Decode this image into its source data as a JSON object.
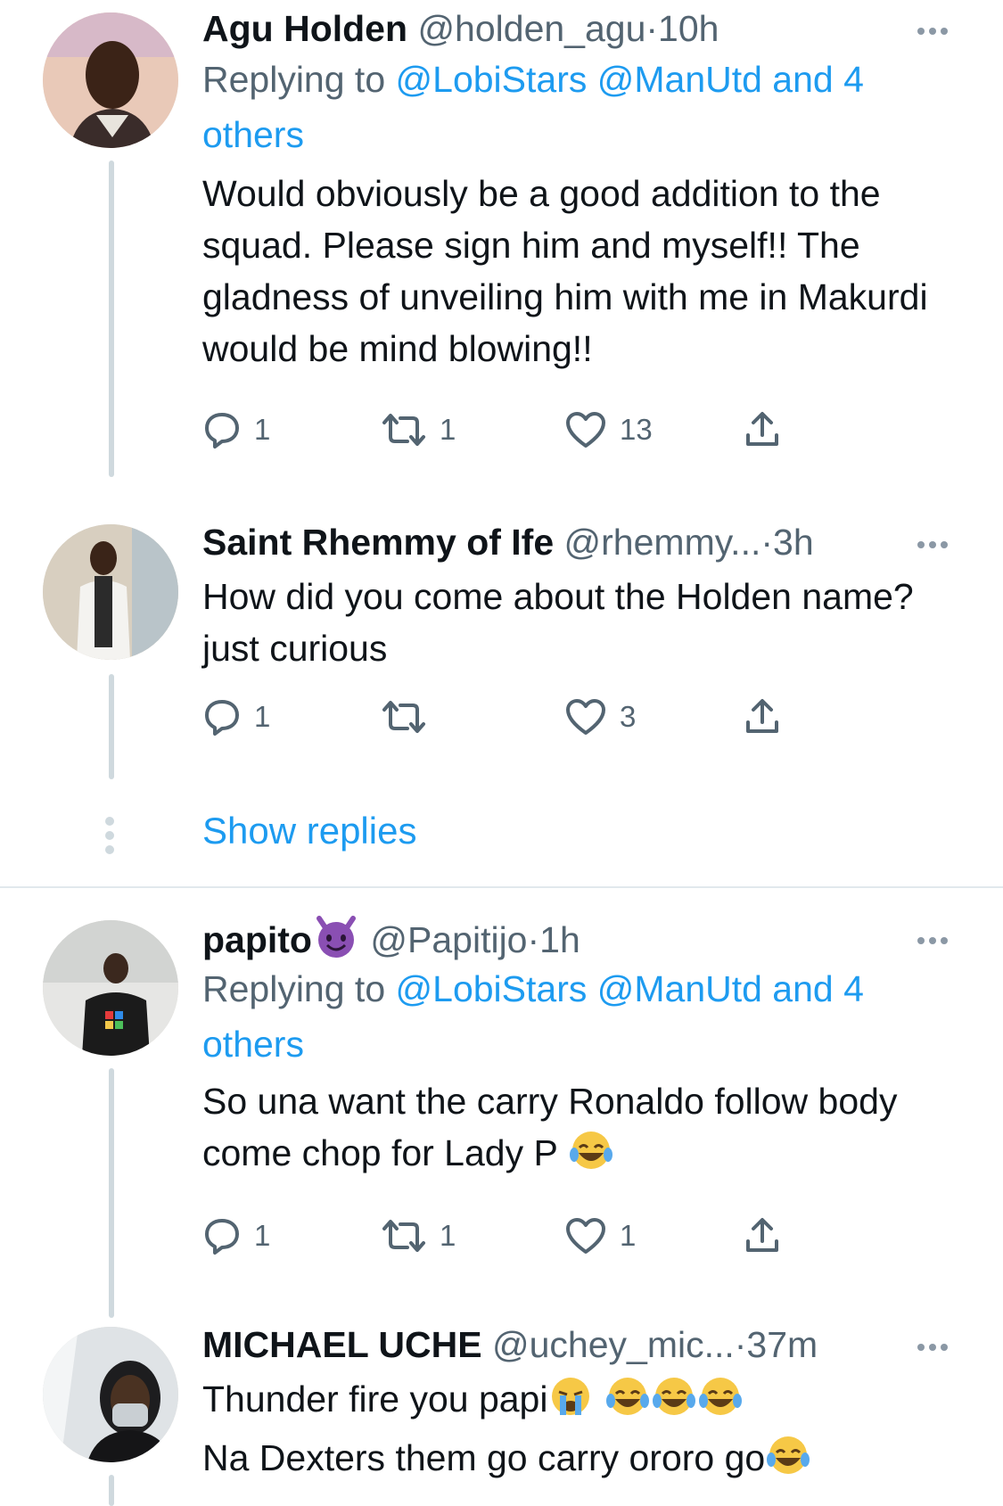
{
  "tweets": [
    {
      "name": "Agu Holden",
      "handle": "@holden_agu",
      "dot": "·",
      "time": "10h",
      "replying_prefix": "Replying to ",
      "replying_links": "@LobiStars @ManUtd and 4 others",
      "text": "Would obviously be a good addition to the squad. Please sign him and myself!! The gladness of unveiling him with me in Makurdi would be mind blowing!!",
      "replies": "1",
      "retweets": "1",
      "likes": "13"
    },
    {
      "name": "Saint Rhemmy of Ife",
      "handle": "@rhemmy...",
      "dot": "·",
      "time": "3h",
      "text": "How did you come about the Holden name? just curious",
      "replies": "1",
      "retweets": "",
      "likes": "3"
    },
    {
      "name": "papito",
      "handle": "@Papitijo",
      "dot": "·",
      "time": "1h",
      "replying_prefix": "Replying to ",
      "replying_links": "@LobiStars @ManUtd and 4 others",
      "text": "So una want the carry Ronaldo follow body come chop for Lady P",
      "replies": "1",
      "retweets": "1",
      "likes": "1"
    },
    {
      "name": "MICHAEL UCHE",
      "handle": "@uchey_mic...",
      "dot": "·",
      "time": "37m",
      "line1": "Thunder fire you papi",
      "line2": "Na Dexters them go carry ororo go"
    }
  ],
  "show_replies": "Show replies",
  "icons": {
    "reply": "reply-icon",
    "retweet": "retweet-icon",
    "like": "heart-icon",
    "share": "share-icon",
    "more": "more-icon"
  },
  "colors": {
    "link": "#1d9bf0",
    "secondary": "#536471",
    "text": "#0f1419",
    "thread_line": "#cfd9de"
  }
}
